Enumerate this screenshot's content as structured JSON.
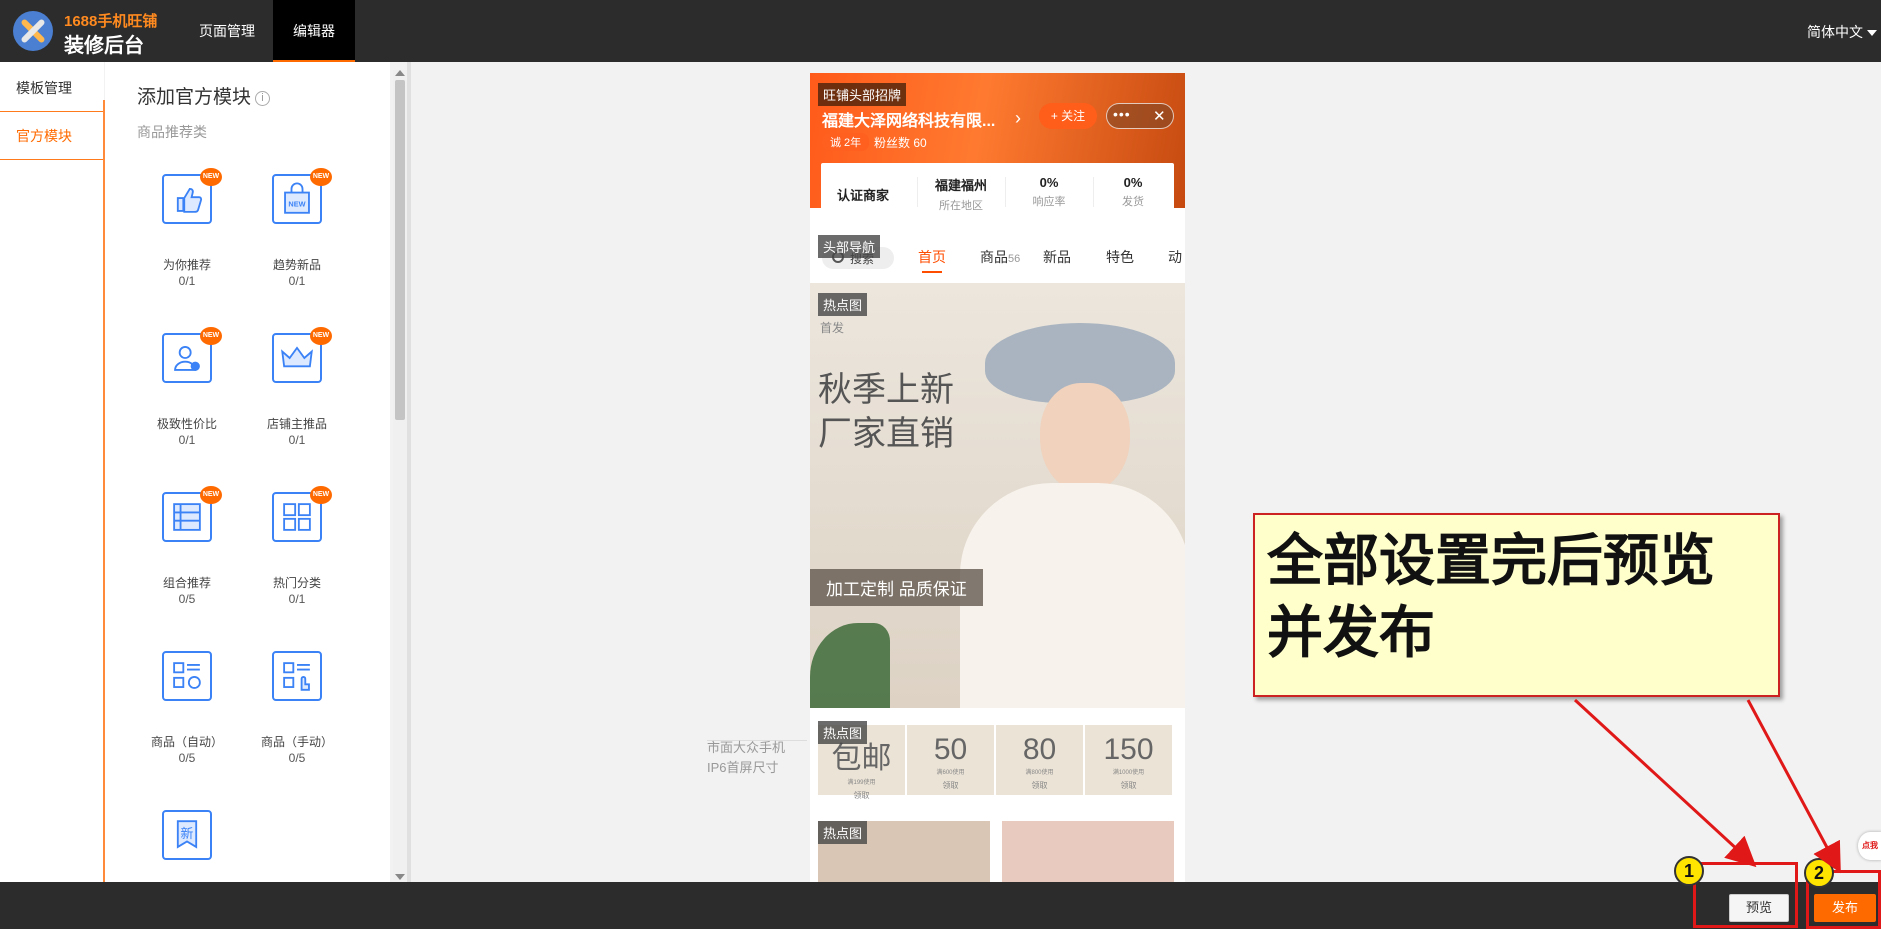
{
  "header": {
    "brand_sub": "1688手机旺铺",
    "brand_main": "装修后台",
    "tabs": [
      {
        "label": "页面管理"
      },
      {
        "label": "编辑器"
      }
    ],
    "language": "简体中文"
  },
  "left_menu": {
    "items": [
      {
        "label": "模板管理"
      },
      {
        "label": "官方模块"
      }
    ]
  },
  "panel": {
    "title": "添加官方模块",
    "info_icon": "i",
    "category": "商品推荐类",
    "modules": [
      {
        "name": "为你推荐",
        "count": "0/1",
        "new": "NEW",
        "icon": "thumbs-up-icon"
      },
      {
        "name": "趋势新品",
        "count": "0/1",
        "new": "NEW",
        "icon": "new-bag-icon"
      },
      {
        "name": "极致性价比",
        "count": "0/1",
        "new": "NEW",
        "icon": "user-badge-icon"
      },
      {
        "name": "店铺主推品",
        "count": "0/1",
        "new": "NEW",
        "icon": "crown-icon"
      },
      {
        "name": "组合推荐",
        "count": "0/5",
        "new": "NEW",
        "icon": "list-icon"
      },
      {
        "name": "热门分类",
        "count": "0/1",
        "new": "NEW",
        "icon": "grid-icon"
      },
      {
        "name": "商品（自动）",
        "count": "0/5",
        "new": "",
        "icon": "auto-list-icon"
      },
      {
        "name": "商品（手动）",
        "count": "0/5",
        "new": "",
        "icon": "manual-list-icon"
      },
      {
        "name": "",
        "count": "",
        "new": "",
        "icon": "new-ribbon-icon",
        "glyph": "新"
      }
    ]
  },
  "phone": {
    "banner_tag": "旺铺头部招牌",
    "shop_name": "福建大泽网络科技有限...",
    "chevron": "›",
    "follow_label": "+ 关注",
    "more_dots": "•••",
    "close_glyph": "✕",
    "years_badge": "诚 2年",
    "fans": "粉丝数 60",
    "verified": "认证商家",
    "stats": [
      {
        "value": "福建福州",
        "label": "所在地区"
      },
      {
        "value": "0%",
        "label": "响应率"
      },
      {
        "value": "0%",
        "label": "发货"
      }
    ],
    "nav_tag": "头部导航",
    "search_label": "搜索",
    "nav_tabs": [
      {
        "label": "首页",
        "count": ""
      },
      {
        "label": "商品",
        "count": "56"
      },
      {
        "label": "新品",
        "count": ""
      },
      {
        "label": "特色",
        "count": ""
      },
      {
        "label": "动",
        "count": ""
      }
    ],
    "hot_tag": "热点图",
    "hero_sub": "首发",
    "hero_line1": "秋季上新",
    "hero_line2": "厂家直销",
    "hero_slogan": "加工定制 品质保证",
    "coupons": [
      {
        "amount": "包邮",
        "cond": "满199使用",
        "get": "领取"
      },
      {
        "amount": "50",
        "cond": "满600使用",
        "get": "领取"
      },
      {
        "amount": "80",
        "cond": "满800使用",
        "get": "领取"
      },
      {
        "amount": "150",
        "cond": "满1000使用",
        "get": "领取"
      }
    ]
  },
  "size_note": {
    "line1": "市面大众手机",
    "line2": "IP6首屏尺寸"
  },
  "callout": {
    "text": "全部设置完后预览并发布"
  },
  "footer": {
    "preview_label": "预览",
    "publish_label": "发布",
    "step1": "1",
    "step2": "2",
    "hint": "点我"
  },
  "colors": {
    "accent": "#ff6a00",
    "topbar": "#2c2c2c",
    "annotation_red": "#e01818",
    "callout_bg": "#ffffcc"
  }
}
